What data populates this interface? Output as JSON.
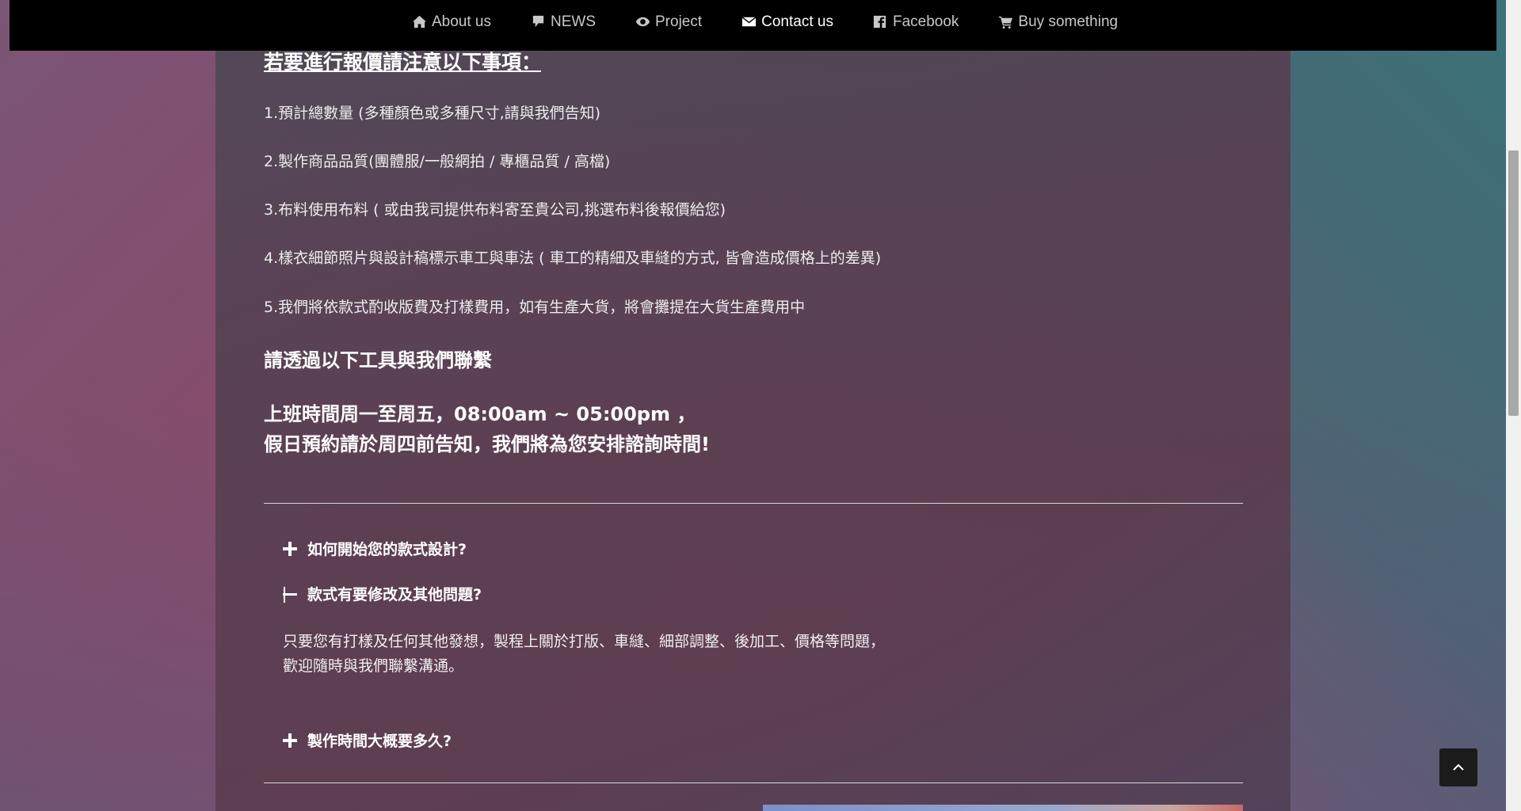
{
  "nav": {
    "items": [
      {
        "label": "About us",
        "icon": "home-icon",
        "active": false
      },
      {
        "label": "NEWS",
        "icon": "comment-icon",
        "active": false
      },
      {
        "label": "Project",
        "icon": "eye-icon",
        "active": false
      },
      {
        "label": "Contact us",
        "icon": "envelope-icon",
        "active": true
      },
      {
        "label": "Facebook",
        "icon": "facebook-icon",
        "active": false
      },
      {
        "label": "Buy something",
        "icon": "cart-icon",
        "active": false
      }
    ]
  },
  "notice": {
    "heading": "若要進行報價請注意以下事項：",
    "items": [
      "1.預計總數量 (多種顏色或多種尺寸,請與我們告知)",
      "2.製作商品品質(團體服/一般網拍 / 專櫃品質 / 高檔)",
      "3.布料使用布料 ( 或由我司提供布料寄至貴公司,挑選布料後報價給您)",
      "4.樣衣細節照片與設計稿標示車工與車法 ( 車工的精細及車縫的方式, 皆會造成價格上的差異)",
      "5.我們將依款式酌收版費及打樣費用，如有生產大貨，將會攤提在大貨生產費用中"
    ]
  },
  "contact": {
    "heading": "請透過以下工具與我們聯繫",
    "hours_line1": "上班時間周一至周五，08:00am ~ 05:00pm ，",
    "hours_line2": "假日預約請於周四前告知，我們將為您安排諮詢時間!"
  },
  "faq": {
    "items": [
      {
        "title": "如何開始您的款式設計?",
        "expanded": false
      },
      {
        "title": "款式有要修改及其他問題?",
        "expanded": true,
        "body_line1": "只要您有打樣及任何其他發想，製程上關於打版、車縫、細部調整、後加工、價格等問題，",
        "body_line2": "歡迎隨時與我們聯繫溝通。"
      },
      {
        "title": "製作時間大概要多久?",
        "expanded": false
      }
    ]
  },
  "colors": {
    "navbar_bg": "#000000",
    "nav_text": "#c8c8c8",
    "nav_active": "#ffffff",
    "text": "#ececec"
  }
}
